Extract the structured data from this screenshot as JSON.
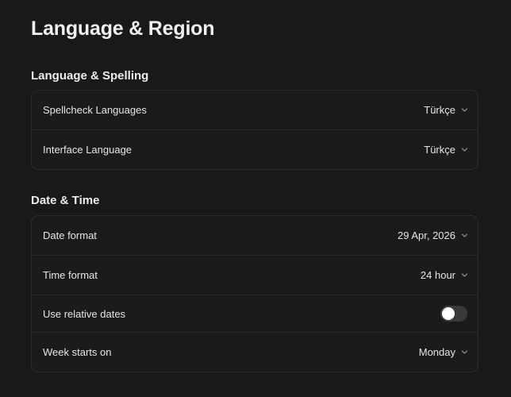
{
  "page": {
    "title": "Language & Region"
  },
  "sections": [
    {
      "title": "Language & Spelling",
      "rows": [
        {
          "label": "Spellcheck Languages",
          "value": "Türkçe"
        },
        {
          "label": "Interface Language",
          "value": "Türkçe"
        }
      ]
    },
    {
      "title": "Date & Time",
      "rows": [
        {
          "label": "Date format",
          "value": "29 Apr, 2026"
        },
        {
          "label": "Time format",
          "value": "24 hour"
        },
        {
          "label": "Use relative dates",
          "toggle_on": false
        },
        {
          "label": "Week starts on",
          "value": "Monday"
        }
      ]
    }
  ],
  "icons": {
    "select_chevron": "chevron-down-icon"
  },
  "colors": {
    "background": "#191919",
    "card_border": "#2b2b2b",
    "text": "#e6e6e6",
    "toggle_off": "#3a3a3a",
    "toggle_knob": "#ffffff"
  }
}
